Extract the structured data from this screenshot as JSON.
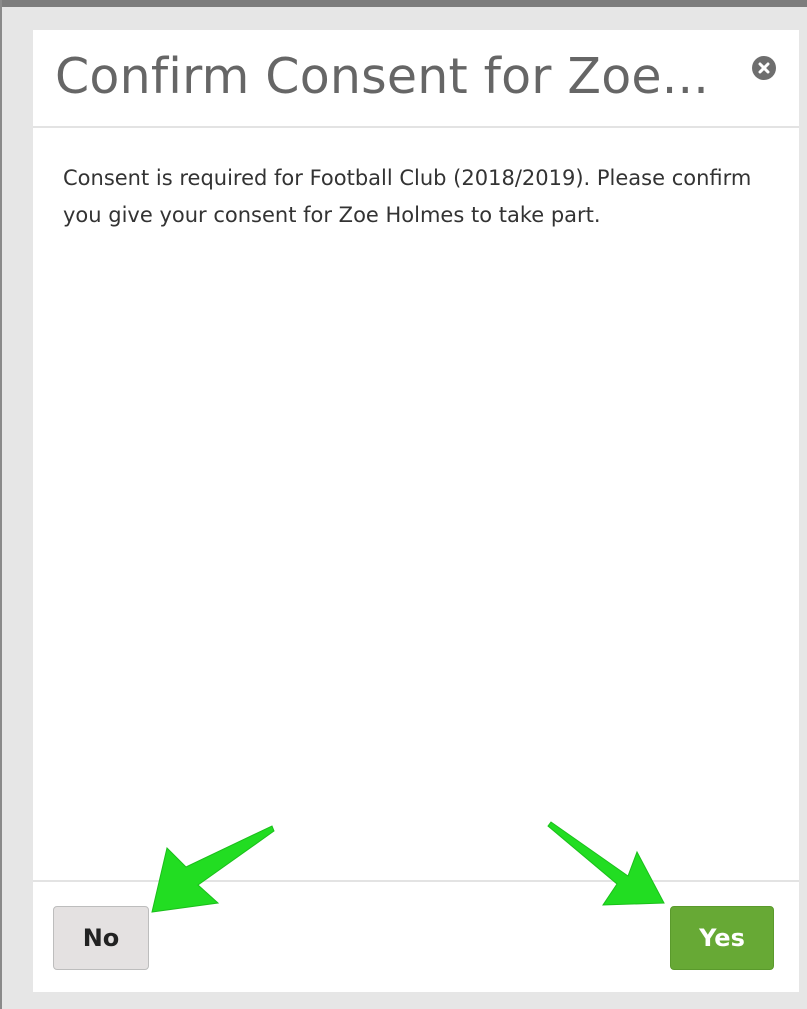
{
  "dialog": {
    "title": "Confirm Consent for Zoe...",
    "message": "Consent is required for Football Club (2018/2019). Please confirm you give your consent for Zoe Holmes to take part.",
    "close_icon": "close-circle-icon"
  },
  "footer": {
    "no_label": "No",
    "yes_label": "Yes"
  },
  "annotations": {
    "arrow_color": "#22dd22",
    "count": 2
  },
  "colors": {
    "yes_button": "#67a935",
    "no_button": "#e4e1e1",
    "title_text": "#666666"
  }
}
